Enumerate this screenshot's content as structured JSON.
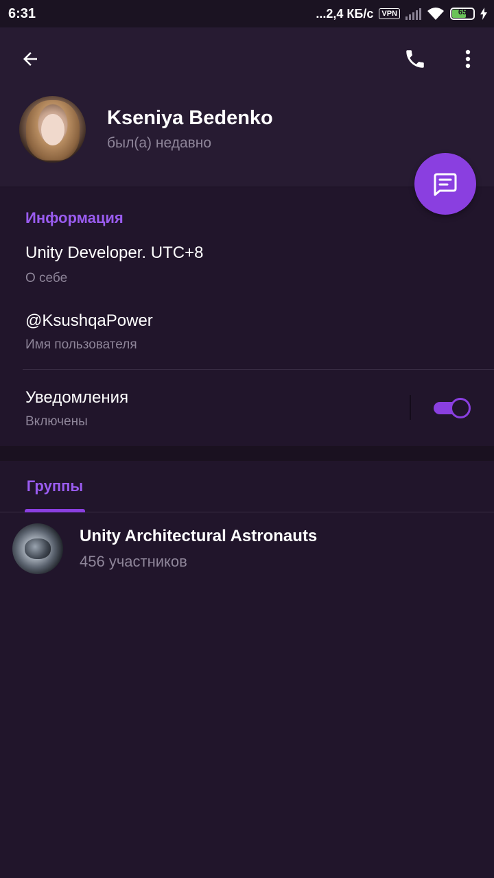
{
  "status_bar": {
    "time": "6:31",
    "network_speed": "...2,4 КБ/с",
    "vpn": "VPN",
    "battery": "65"
  },
  "profile": {
    "name": "Kseniya Bedenko",
    "last_seen": "был(а) недавно"
  },
  "info": {
    "section_title": "Информация",
    "bio_value": "Unity Developer. UTC+8",
    "bio_label": "О себе",
    "username_value": "@KsushqaPower",
    "username_label": "Имя пользователя",
    "notifications_value": "Уведомления",
    "notifications_label": "Включены",
    "notifications_enabled": true
  },
  "tabs": {
    "groups_label": "Группы"
  },
  "groups": [
    {
      "name": "Unity Architectural Astronauts",
      "members": "456 участников"
    }
  ],
  "colors": {
    "accent": "#8a3fe0",
    "accent_text": "#9a5cf0",
    "background": "#21152b",
    "header_bg": "#271b32"
  },
  "icons": {
    "back": "arrow-left-icon",
    "call": "phone-icon",
    "more": "more-vertical-icon",
    "message": "message-icon"
  }
}
